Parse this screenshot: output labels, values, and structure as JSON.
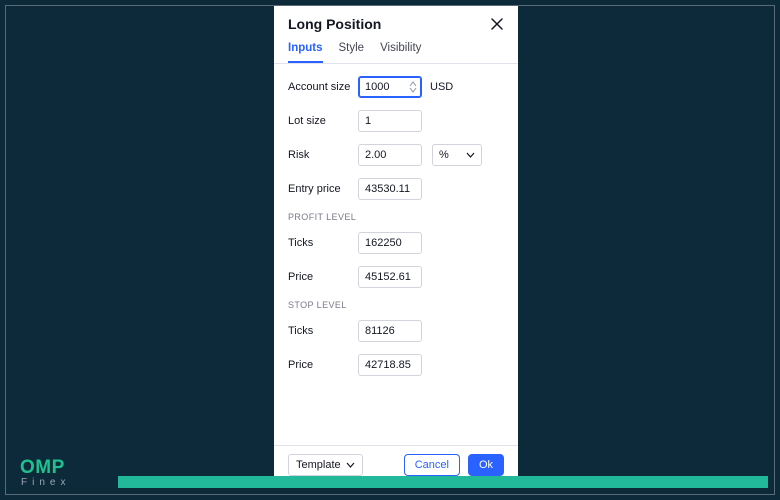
{
  "dialog": {
    "title": "Long Position",
    "tabs": {
      "inputs": "Inputs",
      "style": "Style",
      "visibility": "Visibility"
    },
    "fields": {
      "account_size_label": "Account size",
      "account_size_value": "1000",
      "account_size_suffix": "USD",
      "lot_size_label": "Lot size",
      "lot_size_value": "1",
      "risk_label": "Risk",
      "risk_value": "2.00",
      "risk_unit": "%",
      "entry_price_label": "Entry price",
      "entry_price_value": "43530.11"
    },
    "profit": {
      "heading": "PROFIT LEVEL",
      "ticks_label": "Ticks",
      "ticks_value": "162250",
      "price_label": "Price",
      "price_value": "45152.61"
    },
    "stop": {
      "heading": "STOP LEVEL",
      "ticks_label": "Ticks",
      "ticks_value": "81126",
      "price_label": "Price",
      "price_value": "42718.85"
    },
    "footer": {
      "template_label": "Template",
      "cancel_label": "Cancel",
      "ok_label": "Ok"
    }
  },
  "brand": {
    "top": "OMP",
    "sub": "Finex"
  }
}
